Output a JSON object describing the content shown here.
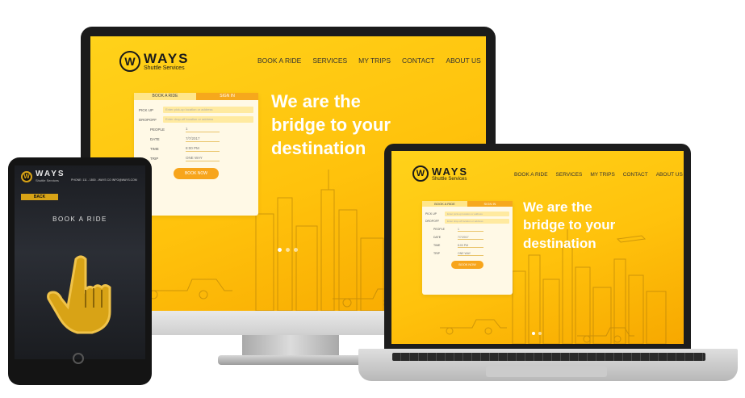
{
  "brand": {
    "name": "WAYS",
    "tagline": "Shuttle Services",
    "logo_letter": "W"
  },
  "nav": [
    "BOOK A RIDE",
    "SERVICES",
    "MY TRIPS",
    "CONTACT",
    "ABOUT US"
  ],
  "hero": {
    "line1": "We are the",
    "line2": "bridge to your",
    "line3": "destination"
  },
  "form": {
    "tab_book": "BOOK A RIDE",
    "tab_signin": "SIGN IN",
    "pickup_label": "PICK UP",
    "pickup_placeholder": "Enter pick-up location or address",
    "dropoff_label": "DROPOFF",
    "dropoff_placeholder": "Enter drop-off location or address",
    "people_label": "PEOPLE",
    "people_value": "1",
    "date_label": "DATE",
    "date_value": "7/7/2017",
    "time_label": "TIME",
    "time_value": "8:00 PM",
    "trip_label": "TRIP",
    "trip_value": "ONE WAY",
    "book_button": "BOOK NOW"
  },
  "tablet": {
    "back_button": "BACK",
    "title": "BOOK A RIDE",
    "contact_text": "PHONE: 111 - 1800 - WAYS CO  INFO@WAYS.COM"
  },
  "colors": {
    "accent": "#ffc20c",
    "accent_dark": "#f7a51c",
    "dark": "#1a1a1a",
    "gold": "#d8a316"
  }
}
